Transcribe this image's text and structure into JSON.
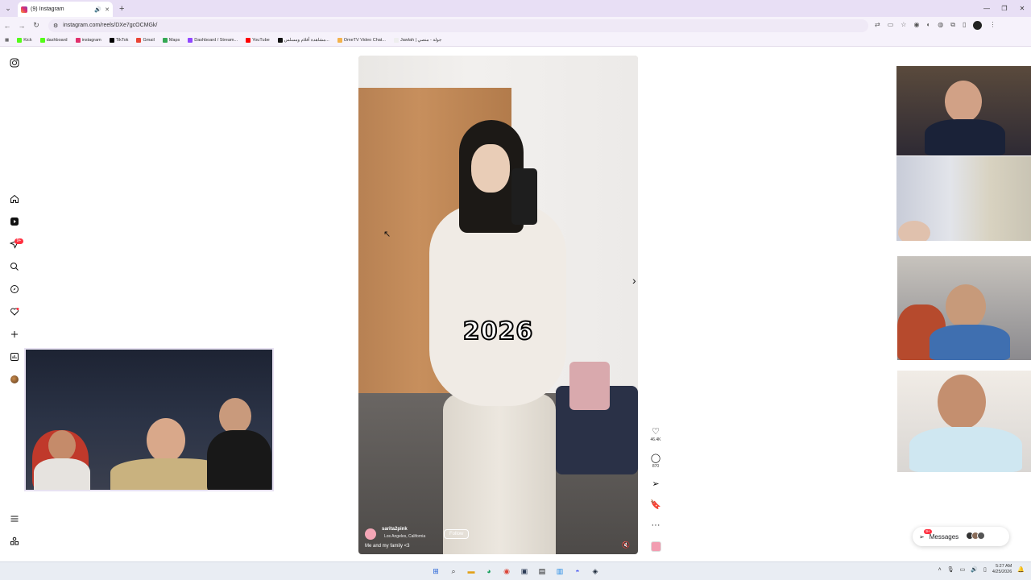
{
  "browser": {
    "tab_title": "(9) Instagram",
    "url": "instagram.com/reels/DXe7gcOCMGk/",
    "bookmarks": [
      "Kick",
      "dashboard",
      "instagram",
      "TikTok",
      "Gmail",
      "Maps",
      "Dashboard / Stream...",
      "YouTube",
      "مشاهدة أفلام ومسلس...",
      "OmeTV Video Chat...",
      "Jawlah | جولة - منصي"
    ]
  },
  "sidebar": {
    "notification_badge": "9+",
    "icons": [
      "instagram-logo-icon",
      "home-icon",
      "reels-icon",
      "direct-icon",
      "search-icon",
      "explore-icon",
      "heart-icon",
      "create-icon",
      "dashboard-icon",
      "profile-avatar",
      "menu-icon",
      "more-apps-icon"
    ]
  },
  "reel": {
    "overlay_text": "2026",
    "author": "sarita2pink",
    "location": "Los Angeles, California",
    "follow_label": "Follow",
    "caption": "Me and my family <3"
  },
  "actions": {
    "likes": "46.4K",
    "comments": "870"
  },
  "messages": {
    "label": "Messages",
    "badge": "9+"
  },
  "taskbar": {
    "time": "5:27 AM",
    "date": "4/25/2026"
  },
  "colors": {
    "badge_red": "#ff3040",
    "tab_bar": "#e8dff5",
    "toolbar": "#f6f2fb"
  }
}
